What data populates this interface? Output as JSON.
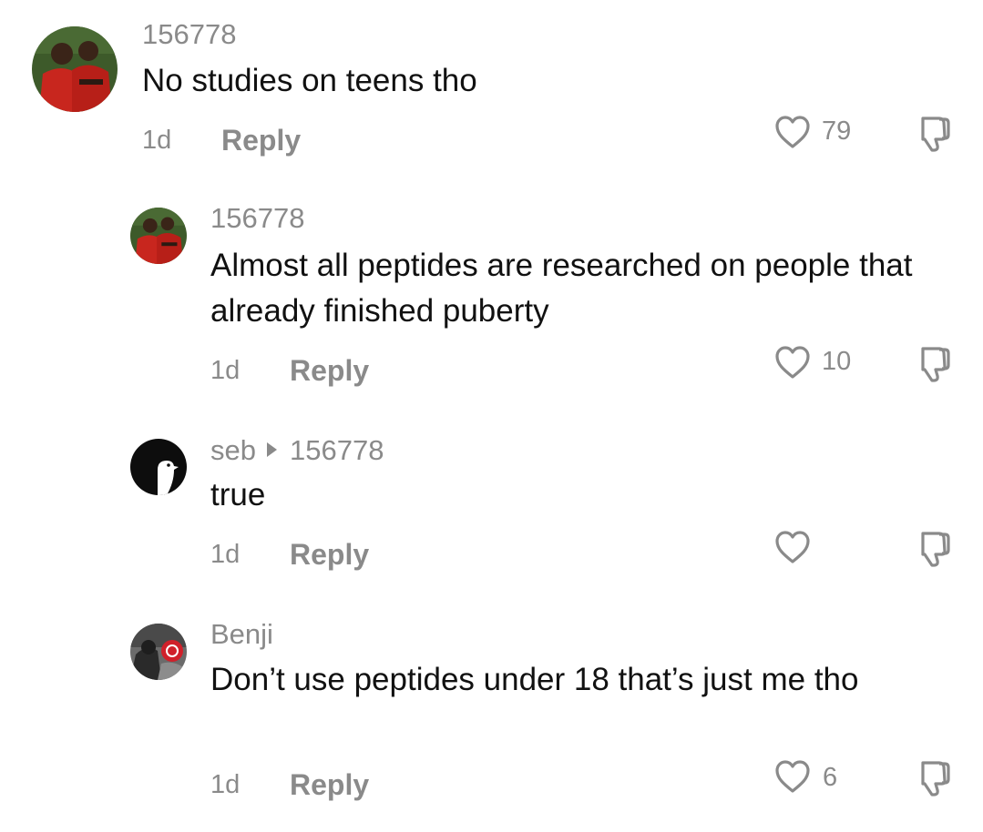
{
  "comments": [
    {
      "username": "156778",
      "reply_to": "",
      "text": "No studies on teens tho",
      "age": "1d",
      "reply_label": "Reply",
      "likes": "79"
    },
    {
      "username": "156778",
      "reply_to": "",
      "text": "Almost all peptides are researched on people that already finished puberty",
      "age": "1d",
      "reply_label": "Reply",
      "likes": "10"
    },
    {
      "username": "seb",
      "reply_to": "156778",
      "text": "true",
      "age": "1d",
      "reply_label": "Reply",
      "likes": ""
    },
    {
      "username": "Benji",
      "reply_to": "",
      "text": "Don’t use peptides under 18 that’s just me tho",
      "age": "1d",
      "reply_label": "Reply",
      "likes": "6"
    }
  ],
  "icons": {
    "like": "heart-outline-icon",
    "dislike": "thumbs-down-outline-icon"
  },
  "colors": {
    "text": "#111111",
    "meta": "#8a8a8a",
    "background": "#ffffff"
  }
}
